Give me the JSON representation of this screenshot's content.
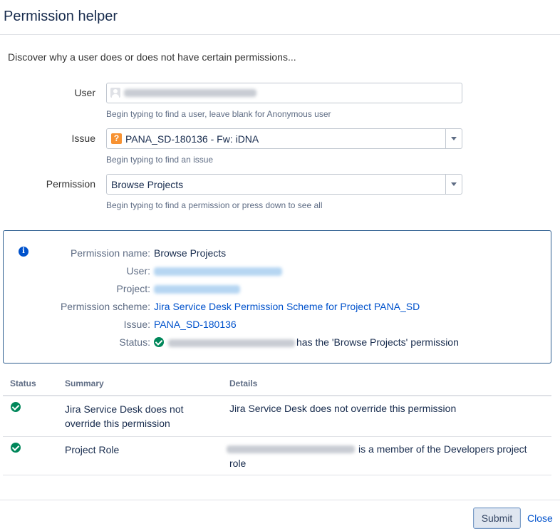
{
  "dialog": {
    "title": "Permission helper",
    "intro": "Discover why a user does or does not have certain permissions..."
  },
  "form": {
    "user": {
      "label": "User",
      "help": "Begin typing to find a user, leave blank for Anonymous user"
    },
    "issue": {
      "label": "Issue",
      "icon": "question-issue-type-icon",
      "value": "PANA_SD-180136 - Fw: iDNA",
      "help": "Begin typing to find an issue"
    },
    "permission": {
      "label": "Permission",
      "value": "Browse Projects",
      "help": "Begin typing to find a permission or press down to see all"
    }
  },
  "result": {
    "permission_name_label": "Permission name:",
    "permission_name": "Browse Projects",
    "user_label": "User:",
    "project_label": "Project:",
    "scheme_label": "Permission scheme:",
    "scheme": "Jira Service Desk Permission Scheme for Project PANA_SD",
    "issue_label": "Issue:",
    "issue": "PANA_SD-180136",
    "status_label": "Status:",
    "status_text": "has the 'Browse Projects' permission"
  },
  "table": {
    "headers": [
      "Status",
      "Summary",
      "Details"
    ],
    "rows": [
      {
        "summary_line1": "Jira Service Desk does not",
        "summary_line2": "override this permission",
        "details": "Jira Service Desk does not override this permission"
      },
      {
        "summary": "Project Role",
        "details_line1": "is a member of the Developers project",
        "details_line2": "role"
      }
    ]
  },
  "buttons": {
    "submit": "Submit",
    "close": "Close"
  },
  "colors": {
    "link": "#0052cc",
    "success": "#00875a",
    "panel_border": "#2c5d8f"
  }
}
